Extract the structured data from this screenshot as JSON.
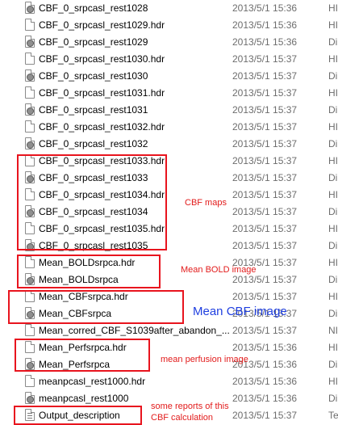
{
  "files": [
    {
      "name": "CBF_0_srpcasl_rest1028",
      "date": "2013/5/1 15:36",
      "type": "HI",
      "icon": "image-file-icon"
    },
    {
      "name": "CBF_0_srpcasl_rest1029.hdr",
      "date": "2013/5/1 15:36",
      "type": "HI",
      "icon": "file-icon"
    },
    {
      "name": "CBF_0_srpcasl_rest1029",
      "date": "2013/5/1 15:36",
      "type": "Di",
      "icon": "image-file-icon"
    },
    {
      "name": "CBF_0_srpcasl_rest1030.hdr",
      "date": "2013/5/1 15:37",
      "type": "HI",
      "icon": "file-icon"
    },
    {
      "name": "CBF_0_srpcasl_rest1030",
      "date": "2013/5/1 15:37",
      "type": "Di",
      "icon": "image-file-icon"
    },
    {
      "name": "CBF_0_srpcasl_rest1031.hdr",
      "date": "2013/5/1 15:37",
      "type": "HI",
      "icon": "file-icon"
    },
    {
      "name": "CBF_0_srpcasl_rest1031",
      "date": "2013/5/1 15:37",
      "type": "Di",
      "icon": "image-file-icon"
    },
    {
      "name": "CBF_0_srpcasl_rest1032.hdr",
      "date": "2013/5/1 15:37",
      "type": "HI",
      "icon": "file-icon"
    },
    {
      "name": "CBF_0_srpcasl_rest1032",
      "date": "2013/5/1 15:37",
      "type": "Di",
      "icon": "image-file-icon"
    },
    {
      "name": "CBF_0_srpcasl_rest1033.hdr",
      "date": "2013/5/1 15:37",
      "type": "HI",
      "icon": "file-icon"
    },
    {
      "name": "CBF_0_srpcasl_rest1033",
      "date": "2013/5/1 15:37",
      "type": "Di",
      "icon": "image-file-icon"
    },
    {
      "name": "CBF_0_srpcasl_rest1034.hdr",
      "date": "2013/5/1 15:37",
      "type": "HI",
      "icon": "file-icon"
    },
    {
      "name": "CBF_0_srpcasl_rest1034",
      "date": "2013/5/1 15:37",
      "type": "Di",
      "icon": "image-file-icon"
    },
    {
      "name": "CBF_0_srpcasl_rest1035.hdr",
      "date": "2013/5/1 15:37",
      "type": "HI",
      "icon": "file-icon"
    },
    {
      "name": "CBF_0_srpcasl_rest1035",
      "date": "2013/5/1 15:37",
      "type": "Di",
      "icon": "image-file-icon"
    },
    {
      "name": "Mean_BOLDsrpca.hdr",
      "date": "2013/5/1 15:37",
      "type": "HI",
      "icon": "file-icon"
    },
    {
      "name": "Mean_BOLDsrpca",
      "date": "2013/5/1 15:37",
      "type": "Di",
      "icon": "image-file-icon"
    },
    {
      "name": "Mean_CBFsrpca.hdr",
      "date": "2013/5/1 15:37",
      "type": "HI",
      "icon": "file-icon"
    },
    {
      "name": "Mean_CBFsrpca",
      "date": "2013/5/1 15:37",
      "type": "Di",
      "icon": "image-file-icon"
    },
    {
      "name": "Mean_corred_CBF_S1039after_abandon_...",
      "date": "2013/5/1 15:37",
      "type": "NI",
      "icon": "file-icon"
    },
    {
      "name": "Mean_Perfsrpca.hdr",
      "date": "2013/5/1 15:36",
      "type": "HI",
      "icon": "file-icon"
    },
    {
      "name": "Mean_Perfsrpca",
      "date": "2013/5/1 15:36",
      "type": "Di",
      "icon": "image-file-icon"
    },
    {
      "name": "meanpcasl_rest1000.hdr",
      "date": "2013/5/1 15:36",
      "type": "HI",
      "icon": "file-icon"
    },
    {
      "name": "meanpcasl_rest1000",
      "date": "2013/5/1 15:36",
      "type": "Di",
      "icon": "image-file-icon"
    },
    {
      "name": "Output_description",
      "date": "2013/5/1 15:37",
      "type": "Te",
      "icon": "text-file-icon"
    }
  ],
  "annotations": {
    "cbf_maps": "CBF maps",
    "mean_bold": "Mean BOLD image",
    "mean_cbf": "Mean CBF image",
    "mean_perfusion": "mean perfusion image",
    "reports_line1": "some reports of this",
    "reports_line2": "CBF calculation"
  },
  "colors": {
    "annotation_red": "#e8141e",
    "annotation_blue": "#1f3fe0",
    "date_gray": "#6d6d6d"
  }
}
